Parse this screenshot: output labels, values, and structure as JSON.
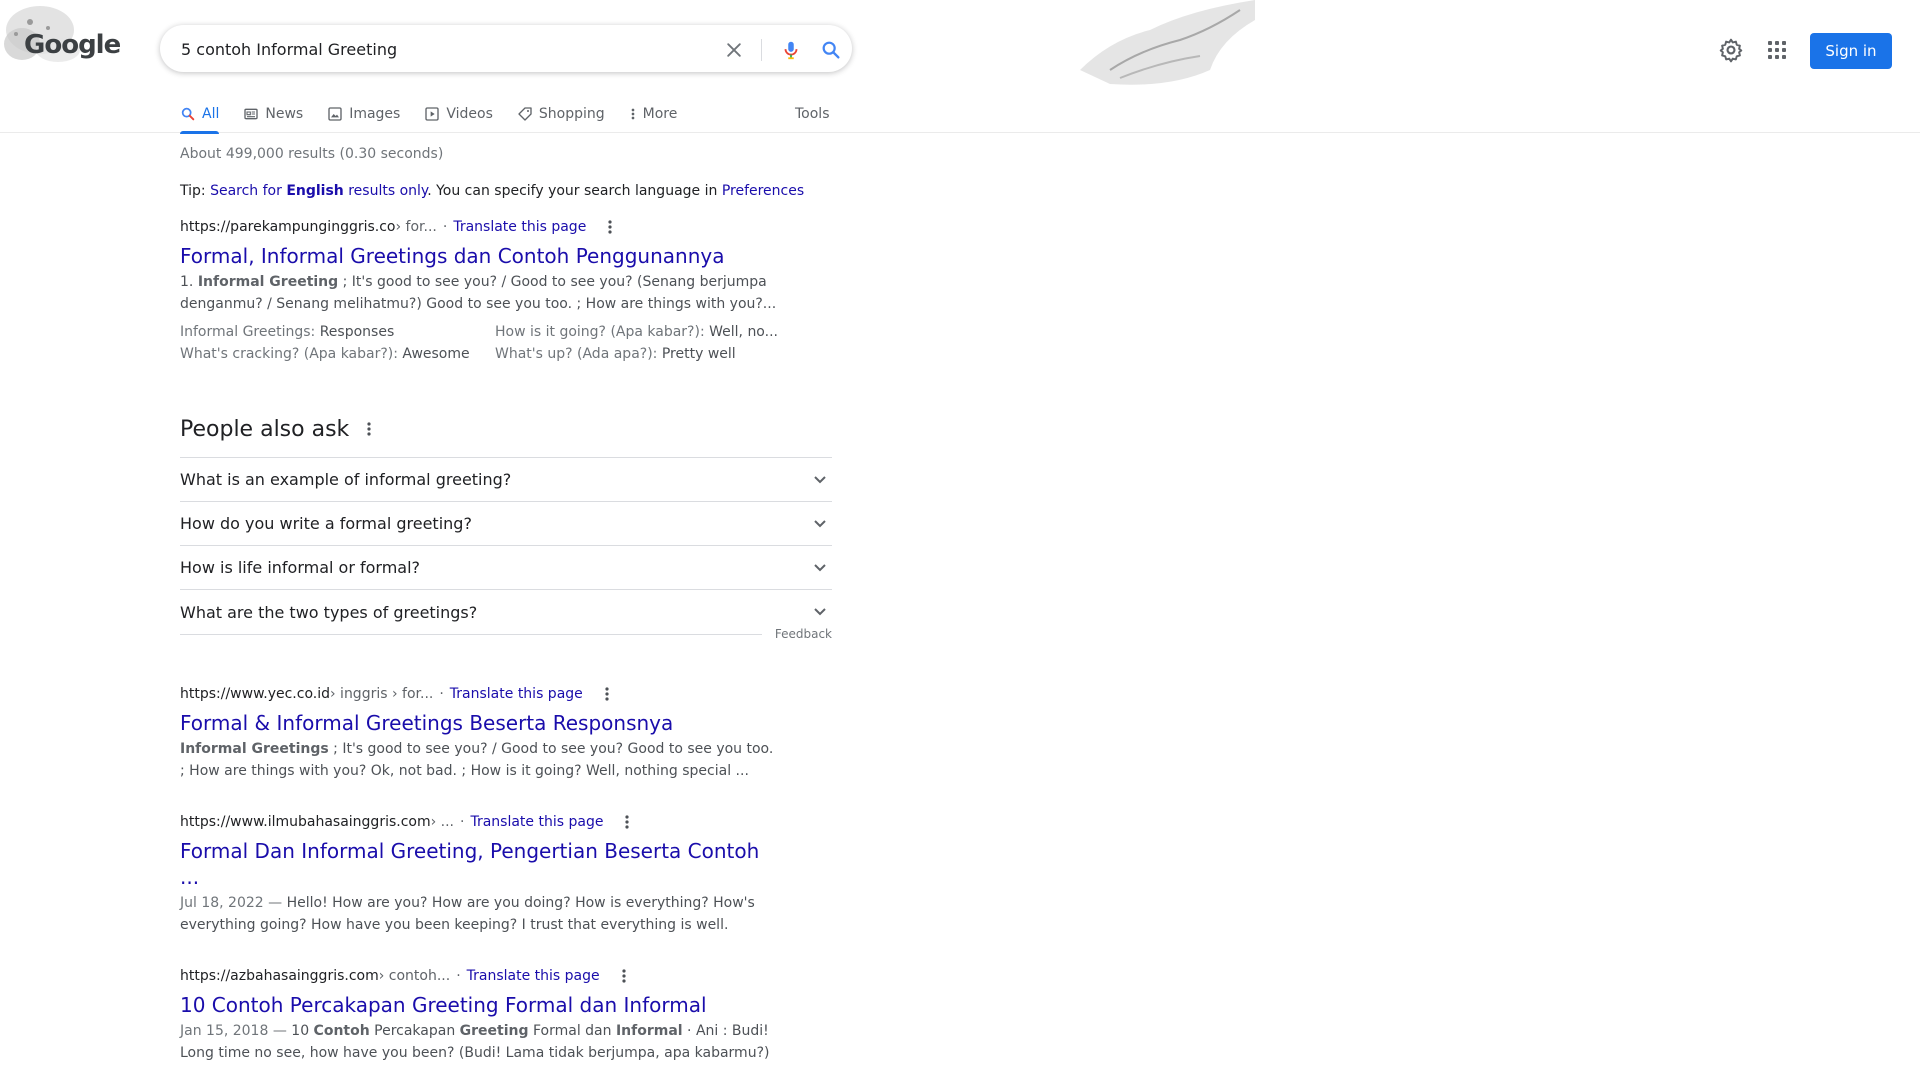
{
  "header": {
    "logo_text": "Google",
    "search_value": "5 contoh Informal Greeting",
    "signin_label": "Sign in",
    "icons": {
      "clear": "close-icon",
      "mic": "mic-icon",
      "search": "search-icon",
      "settings": "gear-icon",
      "apps": "apps-grid-icon"
    },
    "colors": {
      "accent": "#1a73e8",
      "link": "#1a0dab"
    }
  },
  "tabs": [
    {
      "label": "All",
      "active": true,
      "icon": "search-icon"
    },
    {
      "label": "News",
      "icon": "newspaper-icon"
    },
    {
      "label": "Images",
      "icon": "image-icon"
    },
    {
      "label": "Videos",
      "icon": "play-icon"
    },
    {
      "label": "Shopping",
      "icon": "tag-icon"
    },
    {
      "label": "More",
      "icon": "more-vert-icon"
    }
  ],
  "tools_label": "Tools",
  "stats": "About 499,000 results (0.30 seconds)",
  "tip": {
    "prefix": "Tip: ",
    "link_pre": "Search for ",
    "link_bold": "English",
    "link_post": " results only",
    "middle": ". You can specify your search language in ",
    "pref_link": "Preferences"
  },
  "results": [
    {
      "domain": "https://parekampunginggris.co",
      "path": " › for...",
      "translate": "Translate this page",
      "title": "Formal, Informal Greetings dan Contoh Penggunannya",
      "snippet_parts": [
        "1. ",
        "Informal Greeting",
        " ; It's good to see you? / Good to see you? (Senang berjumpa denganmu? / Senang melihatmu?) Good to see you too. ; How are things with you?..."
      ],
      "sitelinks": [
        {
          "key": "Informal Greetings:",
          "value": " Responses"
        },
        {
          "key": "How is it going? (Apa kabar?):",
          "value": " Well, no..."
        },
        {
          "key": "What's cracking? (Apa kabar?):",
          "value": " Awesome"
        },
        {
          "key": "What's up? (Ada apa?):",
          "value": " Pretty well"
        }
      ]
    },
    {
      "domain": "https://www.yec.co.id",
      "path": " › inggris › for...",
      "translate": "Translate this page",
      "title": "Formal & Informal Greetings Beserta Responsnya",
      "snippet_parts": [
        "",
        "Informal Greetings",
        " ; It's good to see you? / Good to see you? Good to see you too. ; How are things with you? Ok, not bad. ; How is it going? Well, nothing special ..."
      ]
    },
    {
      "domain": "https://www.ilmubahasainggris.com",
      "path": " › ...",
      "translate": "Translate this page",
      "title_line1": "Formal Dan Informal Greeting, Pengertian Beserta Contoh",
      "title_line2": "...",
      "date": "Jul 18, 2022 — ",
      "snippet": "Hello! How are you? How are you doing? How is everything? How's everything going? How have you been keeping? I trust that everything is well."
    },
    {
      "domain": "https://azbahasainggris.com",
      "path": " › contoh...",
      "translate": "Translate this page",
      "title": "10 Contoh Percakapan Greeting Formal dan Informal",
      "date": "Jan 15, 2018 — ",
      "snippet_parts": [
        "10 ",
        "Contoh",
        " Percakapan ",
        "Greeting",
        " Formal dan ",
        "Informal",
        " · Ani : Budi! Long time no see, how have you been? (Budi! Lama tidak berjumpa, apa kabarmu?)"
      ]
    }
  ],
  "paa": {
    "heading": "People also ask",
    "questions": [
      "What is an example of informal greeting?",
      "How do you write a formal greeting?",
      "How is life informal or formal?",
      "What are the two types of greetings?"
    ],
    "feedback": "Feedback"
  }
}
